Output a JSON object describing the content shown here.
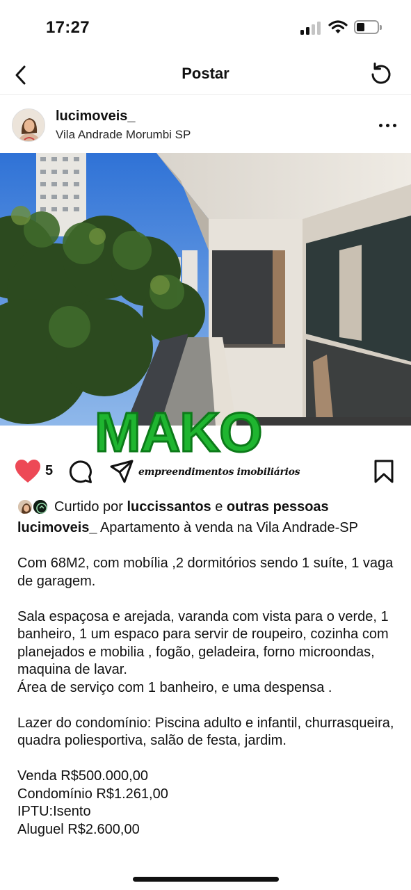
{
  "status_bar": {
    "time": "17:27",
    "battery_level": 0.3
  },
  "nav": {
    "title": "Postar",
    "back_icon": "chevron-left-icon",
    "refresh_icon": "refresh-icon"
  },
  "post": {
    "username": "lucimoveis_",
    "location": "Vila Andrade Morumbi SP",
    "logo_text": "MAKO",
    "logo_subtitle": "empreendimentos imobiliários",
    "like_count": "5",
    "liked_by": {
      "prefix": "Curtido por",
      "user": "luccissantos",
      "joiner": "e",
      "others": "outras pessoas"
    },
    "caption": {
      "username": "lucimoveis_",
      "title": " Apartamento à venda na Vila Andrade-SP",
      "body": "\n\nCom 68M2, com mobília ,2 dormitórios sendo 1 suíte, 1 vaga de garagem.\n\nSala espaçosa e arejada, varanda com vista para o verde, 1 banheiro, 1 um espaco para servir de roupeiro, cozinha com  planejados e mobilia , fogão, geladeira, forno microondas, maquina de lavar.\nÁrea de serviço com 1 banheiro, e uma despensa .\n\nLazer do condomínio: Piscina adulto e infantil, churrasqueira, quadra poliesportiva, salão de festa, jardim.\n\nVenda R$500.000,00\nCondomínio R$1.261,00\nIPTU:Isento\nAluguel R$2.600,00"
    }
  },
  "colors": {
    "like": "#ed4956",
    "logo_green": "#1fb530",
    "text": "#111111"
  }
}
